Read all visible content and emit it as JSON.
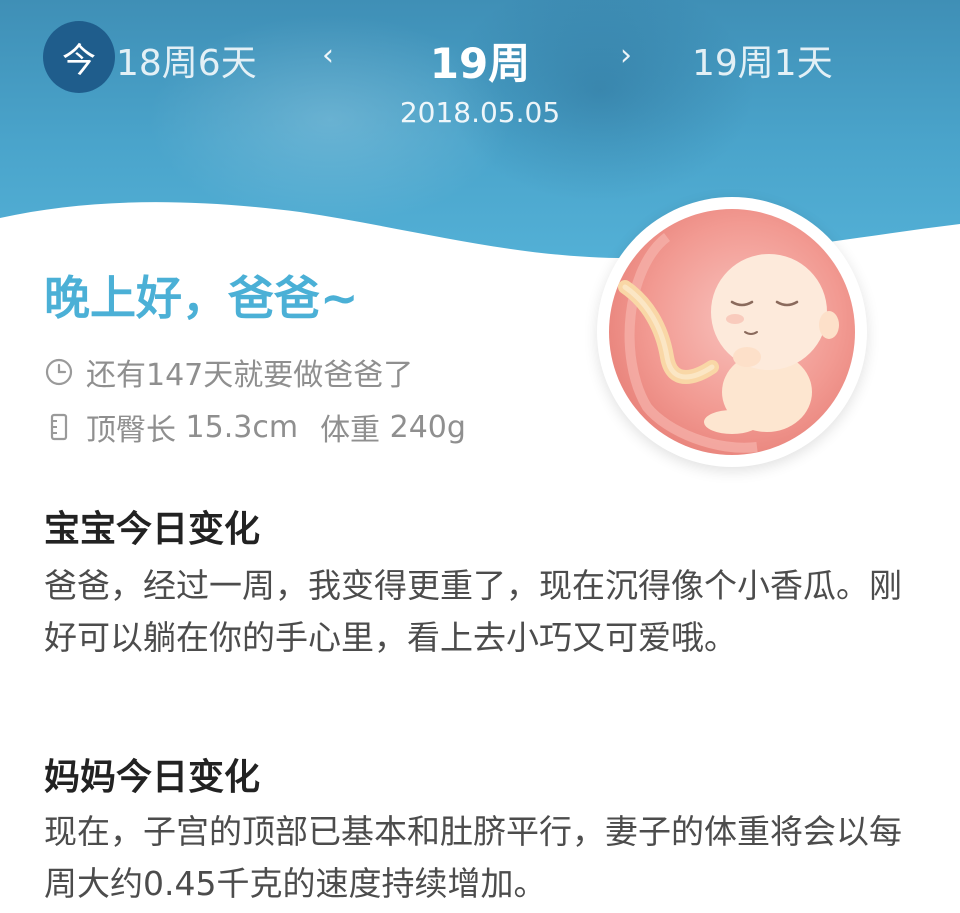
{
  "header": {
    "today_label": "今",
    "prev_week": "18周6天",
    "current_week": "19周",
    "next_week": "19周1天",
    "date": "2018.05.05"
  },
  "greeting": "晚上好，爸爸~",
  "stats": {
    "countdown": "还有147天就要做爸爸了",
    "length_label": "顶臀长",
    "length_value": "15.3cm",
    "weight_label": "体重",
    "weight_value": "240g"
  },
  "sections": [
    {
      "title": "宝宝今日变化",
      "body": "爸爸，经过一周，我变得更重了，现在沉得像个小香瓜。刚好可以躺在你的手心里，看上去小巧又可爱哦。"
    },
    {
      "title": "妈妈今日变化",
      "body": "现在，子宫的顶部已基本和肚脐平行，妻子的体重将会以每周大约0.45千克的速度持续增加。"
    }
  ],
  "colors": {
    "header_blue": "#4aa4cb",
    "today_button": "#1f5d8c",
    "greeting": "#4bb0d6"
  },
  "icons": [
    "clock-icon",
    "ruler-icon",
    "fetus-illustration"
  ]
}
